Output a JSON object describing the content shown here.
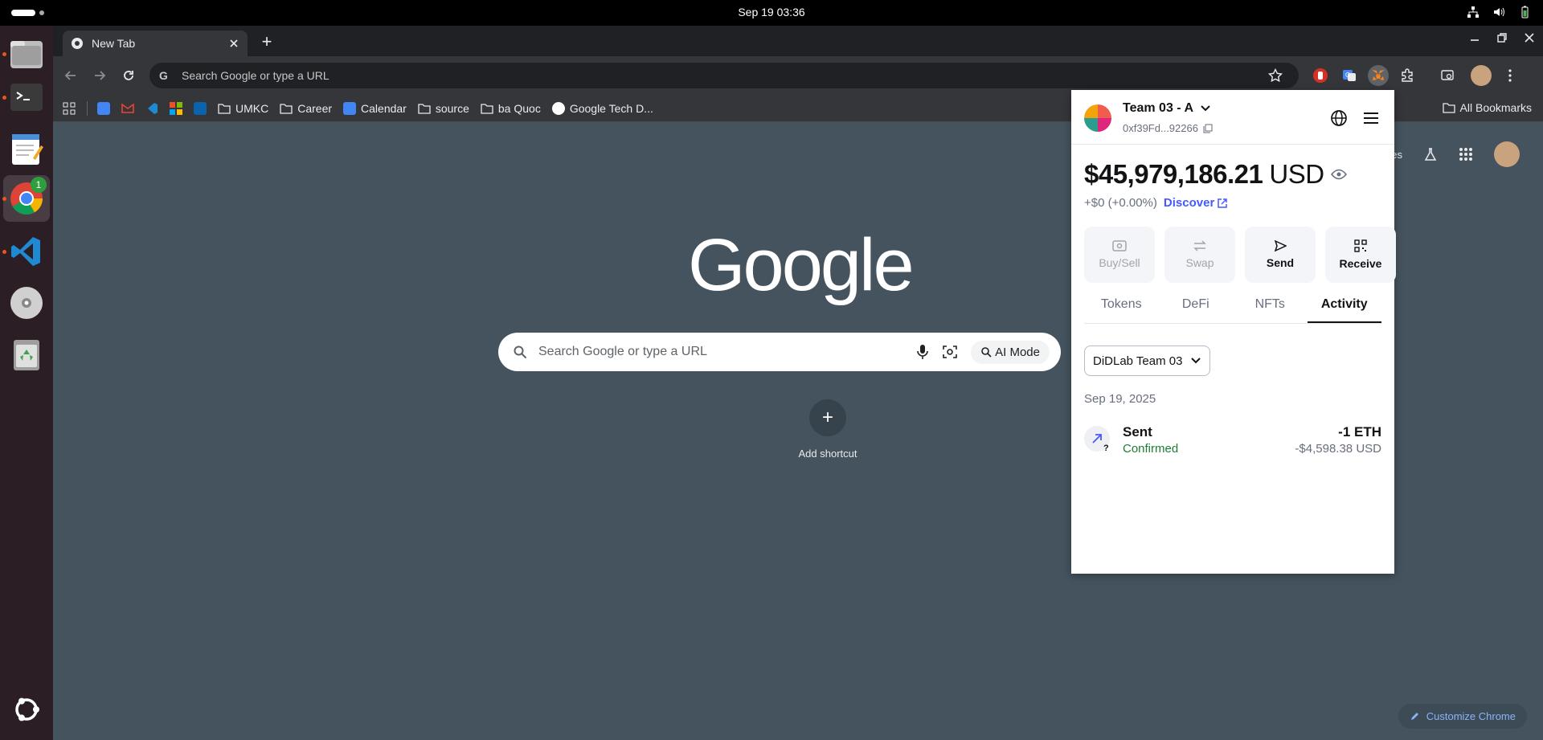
{
  "topbar": {
    "clock": "Sep 19  03:36"
  },
  "dock": {
    "items": [
      {
        "name": "files-icon"
      },
      {
        "name": "terminal-icon"
      },
      {
        "name": "text-editor-icon"
      },
      {
        "name": "chrome-icon",
        "badge": "1"
      },
      {
        "name": "vscode-icon"
      },
      {
        "name": "disc-icon"
      },
      {
        "name": "trash-icon"
      }
    ]
  },
  "browser": {
    "tab_title": "New Tab",
    "omnibox_placeholder": "Search Google or type a URL",
    "bookmarks": [
      "UMKC",
      "Career",
      "Calendar",
      "source",
      "ba Quoc",
      "Google Tech D..."
    ],
    "all_bookmarks": "All Bookmarks"
  },
  "ntp": {
    "logo": "Google",
    "search_placeholder": "Search Google or type a URL",
    "ai_mode": "AI Mode",
    "images_link": "ges",
    "add_shortcut": "Add shortcut",
    "customize": "Customize Chrome"
  },
  "metamask": {
    "account_name": "Team 03 - A",
    "address": "0xf39Fd...92266",
    "balance": "$45,979,186.21",
    "currency": "USD",
    "change": "+$0 (+0.00%)",
    "discover": "Discover",
    "actions": [
      {
        "label": "Buy/Sell",
        "enabled": false
      },
      {
        "label": "Swap",
        "enabled": false
      },
      {
        "label": "Send",
        "enabled": true
      },
      {
        "label": "Receive",
        "enabled": true
      }
    ],
    "tabs": [
      "Tokens",
      "DeFi",
      "NFTs",
      "Activity"
    ],
    "active_tab": "Activity",
    "network_filter": "DiDLab Team 03",
    "date_header": "Sep 19, 2025",
    "transaction": {
      "title": "Sent",
      "status": "Confirmed",
      "amount": "-1 ETH",
      "fiat": "-$4,598.38 USD"
    }
  }
}
